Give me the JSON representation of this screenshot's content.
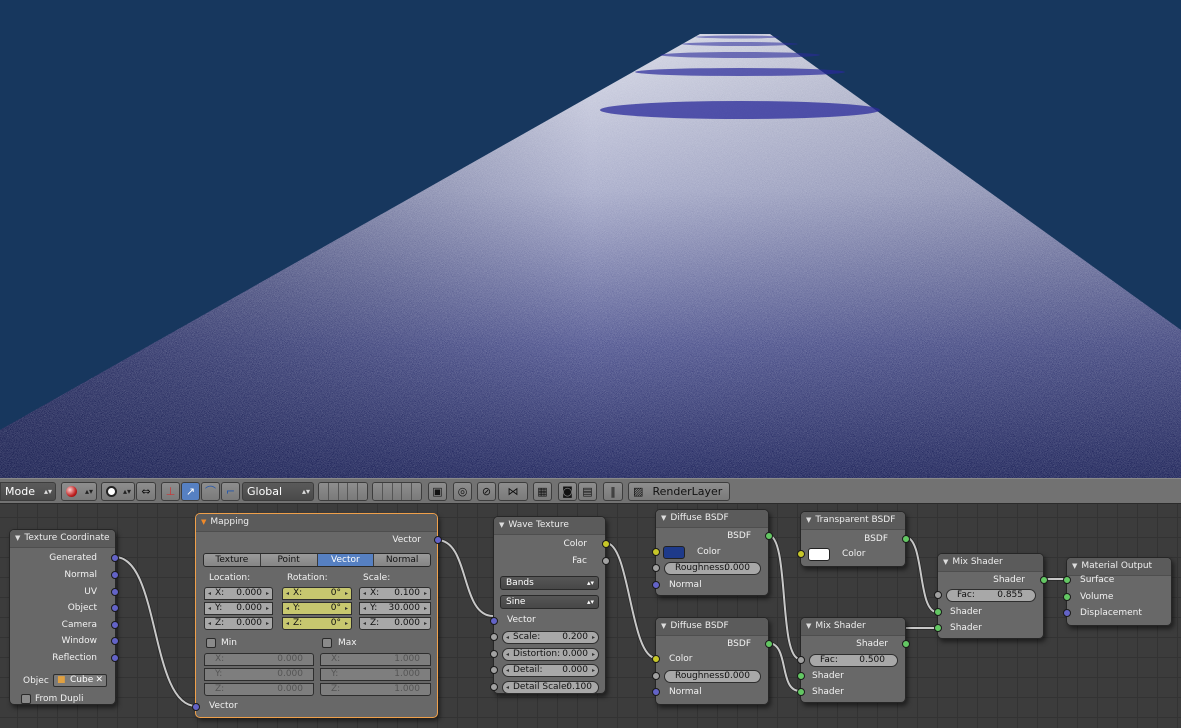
{
  "header": {
    "mode_label": "Mode",
    "orientation_label": "Global",
    "render_layer": "RenderLayer"
  },
  "nodes": {
    "texture_coordinate": {
      "title": "Texture Coordinate",
      "outputs": [
        "Generated",
        "Normal",
        "UV",
        "Object",
        "Camera",
        "Window",
        "Reflection"
      ],
      "object_label": "Objec",
      "object_value": "Cube",
      "from_dupli": "From Dupli"
    },
    "mapping": {
      "title": "Mapping",
      "output": "Vector",
      "tabs": [
        "Texture",
        "Point",
        "Vector",
        "Normal"
      ],
      "active_tab": "Vector",
      "location_label": "Location:",
      "rotation_label": "Rotation:",
      "scale_label": "Scale:",
      "location": [
        {
          "axis": "X:",
          "value": "0.000"
        },
        {
          "axis": "Y:",
          "value": "0.000"
        },
        {
          "axis": "Z:",
          "value": "0.000"
        }
      ],
      "rotation": [
        {
          "axis": "X:",
          "value": "0°"
        },
        {
          "axis": "Y:",
          "value": "0°"
        },
        {
          "axis": "Z:",
          "value": "0°"
        }
      ],
      "scale": [
        {
          "axis": "X:",
          "value": "0.100"
        },
        {
          "axis": "Y:",
          "value": "30.000"
        },
        {
          "axis": "Z:",
          "value": "0.000"
        }
      ],
      "min_label": "Min",
      "max_label": "Max",
      "min": [
        {
          "axis": "X:",
          "value": "0.000"
        },
        {
          "axis": "Y:",
          "value": "0.000"
        },
        {
          "axis": "Z:",
          "value": "0.000"
        }
      ],
      "max": [
        {
          "axis": "X:",
          "value": "1.000"
        },
        {
          "axis": "Y:",
          "value": "1.000"
        },
        {
          "axis": "Z:",
          "value": "1.000"
        }
      ],
      "input": "Vector"
    },
    "wave_texture": {
      "title": "Wave Texture",
      "outputs": [
        "Color",
        "Fac"
      ],
      "type": "Bands",
      "profile": "Sine",
      "vector_label": "Vector",
      "params": [
        {
          "label": "Scale:",
          "value": "0.200"
        },
        {
          "label": "Distortion:",
          "value": "0.000"
        },
        {
          "label": "Detail:",
          "value": "0.000"
        },
        {
          "label": "Detail Scale:",
          "value": "0.100"
        }
      ]
    },
    "diffuse_1": {
      "title": "Diffuse BSDF",
      "output": "BSDF",
      "color_label": "Color",
      "color_value": "#1e3a8a",
      "roughness_label": "Roughness:",
      "roughness": "0.000",
      "normal_label": "Normal"
    },
    "diffuse_2": {
      "title": "Diffuse BSDF",
      "output": "BSDF",
      "color_label": "Color",
      "roughness_label": "Roughness:",
      "roughness": "0.000",
      "normal_label": "Normal"
    },
    "transparent": {
      "title": "Transparent BSDF",
      "output": "BSDF",
      "color_label": "Color",
      "color_value": "#ffffff"
    },
    "mix_1": {
      "title": "Mix Shader",
      "output": "Shader",
      "fac_label": "Fac:",
      "fac": "0.500",
      "inputs": [
        "Shader",
        "Shader"
      ]
    },
    "mix_2": {
      "title": "Mix Shader",
      "output": "Shader",
      "fac_label": "Fac:",
      "fac": "0.855",
      "inputs": [
        "Shader",
        "Shader"
      ]
    },
    "material_output": {
      "title": "Material Output",
      "inputs": [
        "Surface",
        "Volume",
        "Displacement"
      ]
    }
  },
  "colors": {
    "viewport_bg": "#17375e",
    "vector_socket": "#6363c7",
    "color_socket": "#c7c729",
    "shader_socket": "#63c763",
    "active_tab": "#5680c2"
  }
}
